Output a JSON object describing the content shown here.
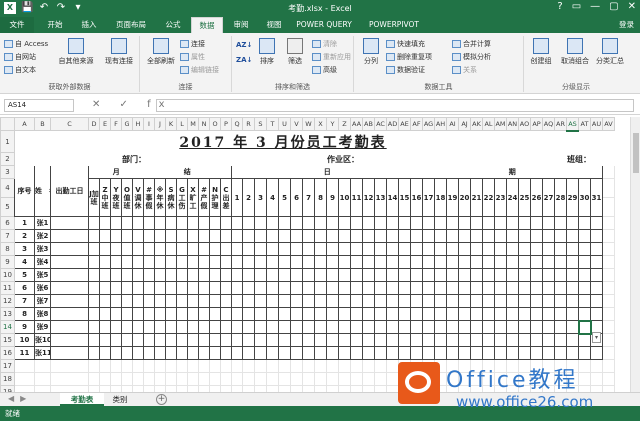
{
  "window": {
    "title": "考勤.xlsx - Excel",
    "qat": [
      "💾",
      "↶",
      "↷",
      "▾"
    ],
    "controls": [
      "?",
      "▭",
      "—",
      "▢",
      "✕"
    ]
  },
  "tabs": [
    "文件",
    "开始",
    "插入",
    "页面布局",
    "公式",
    "数据",
    "审阅",
    "视图",
    "POWER QUERY",
    "POWERPIVOT"
  ],
  "login": "登录",
  "ribbon": {
    "get_external": {
      "label": "获取外部数据",
      "items": [
        "自 Access",
        "自网站",
        "自文本"
      ],
      "big": "自其他来源",
      "existing": "现有连接"
    },
    "connections": {
      "label": "连接",
      "big": "全部刷新",
      "items": [
        "连接",
        "属性",
        "编辑链接"
      ]
    },
    "sortfilter": {
      "label": "排序和筛选",
      "sort_az": "AZ↓",
      "sort_za": "ZA↓",
      "sort": "排序",
      "filter": "筛选",
      "items": [
        "清除",
        "重新应用",
        "高级"
      ]
    },
    "datatools": {
      "label": "数据工具",
      "split": "分列",
      "items": [
        "快速填充",
        "删除重复项",
        "数据验证"
      ],
      "items2": [
        "合并计算",
        "模拟分析",
        "关系"
      ]
    },
    "outline": {
      "label": "分级显示",
      "items": [
        "创建组",
        "取消组合",
        "分类汇总"
      ]
    }
  },
  "formula_bar": {
    "name_box": "AS14",
    "fx": "✕ ✓ fx",
    "value": ""
  },
  "columns": [
    "A",
    "B",
    "C",
    "D",
    "E",
    "F",
    "G",
    "H",
    "I",
    "J",
    "K",
    "L",
    "M",
    "N",
    "O",
    "P",
    "Q",
    "R",
    "S",
    "T",
    "U",
    "V",
    "W",
    "X",
    "Y",
    "Z",
    "AA",
    "AB",
    "AC",
    "AD",
    "AE",
    "AF",
    "AG",
    "AH",
    "AI",
    "AJ",
    "AK",
    "AL",
    "AM",
    "AN",
    "AO",
    "AP",
    "AQ",
    "AR",
    "AS",
    "AT",
    "AU",
    "AV"
  ],
  "rows": [
    "1",
    "2",
    "3",
    "4",
    "5",
    "6",
    "7",
    "8",
    "9",
    "10",
    "11",
    "12",
    "13",
    "14",
    "15",
    "16",
    "17",
    "18",
    "19",
    "20"
  ],
  "sheet": {
    "title": "2017 年 3 月份员工考勤表",
    "dept": "部门：",
    "area": "作业区：",
    "group": "班组：",
    "h_seq": "序号",
    "h_name": "姓　名",
    "h_attend": "出勤工日",
    "h_month": "月",
    "h_settle": "结",
    "h_day": "日",
    "h_period": "期",
    "sub_cols": [
      "J加班",
      "Z中班",
      "Y夜班",
      "O值班",
      "V调休",
      "#事假",
      "※年休",
      "S病休",
      "G工伤",
      "X旷工",
      "#产假",
      "N护理",
      "C出差"
    ],
    "days": [
      "1",
      "2",
      "3",
      "4",
      "5",
      "6",
      "7",
      "8",
      "9",
      "10",
      "11",
      "12",
      "13",
      "14",
      "15",
      "16",
      "17",
      "18",
      "19",
      "20",
      "21",
      "22",
      "23",
      "24",
      "25",
      "26",
      "27",
      "28",
      "29",
      "30",
      "31"
    ],
    "employees": [
      {
        "seq": "1",
        "name": "张1"
      },
      {
        "seq": "2",
        "name": "张2"
      },
      {
        "seq": "3",
        "name": "张3"
      },
      {
        "seq": "4",
        "name": "张4"
      },
      {
        "seq": "5",
        "name": "张5"
      },
      {
        "seq": "6",
        "name": "张6"
      },
      {
        "seq": "7",
        "name": "张7"
      },
      {
        "seq": "8",
        "name": "张8"
      },
      {
        "seq": "9",
        "name": "张9"
      },
      {
        "seq": "10",
        "name": "张10"
      },
      {
        "seq": "11",
        "name": "张11"
      }
    ]
  },
  "sheet_tabs": [
    "考勤表",
    "类别"
  ],
  "status": "就绪",
  "watermark": {
    "line1": "Office教程",
    "line2": "www.office26.com"
  },
  "colors": {
    "excel_green": "#217346"
  }
}
